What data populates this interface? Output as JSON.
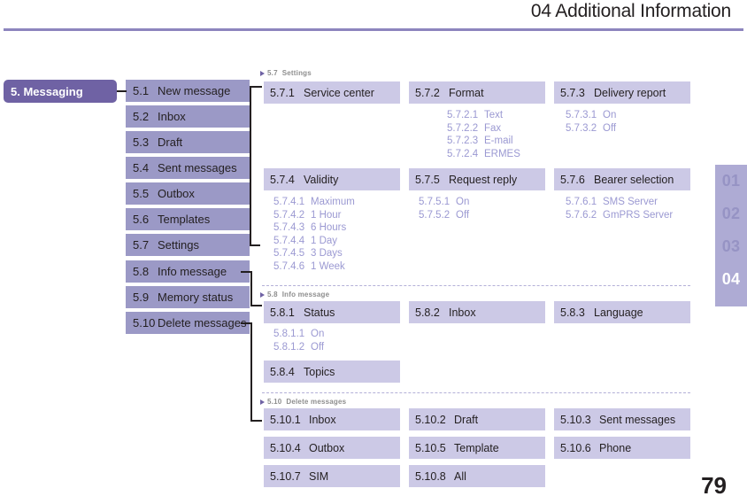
{
  "header": {
    "title": "04 Additional Information"
  },
  "page_number": "79",
  "chapter_tabs": [
    {
      "label": "01",
      "active": false
    },
    {
      "label": "02",
      "active": false
    },
    {
      "label": "03",
      "active": false
    },
    {
      "label": "04",
      "active": true
    }
  ],
  "root": {
    "label": "5. Messaging"
  },
  "menu_level1": [
    {
      "num": "5.1",
      "label": "New message"
    },
    {
      "num": "5.2",
      "label": "Inbox"
    },
    {
      "num": "5.3",
      "label": "Draft"
    },
    {
      "num": "5.4",
      "label": "Sent messages"
    },
    {
      "num": "5.5",
      "label": "Outbox"
    },
    {
      "num": "5.6",
      "label": "Templates"
    },
    {
      "num": "5.7",
      "label": "Settings"
    },
    {
      "num": "5.8",
      "label": "Info message"
    },
    {
      "num": "5.9",
      "label": "Memory status"
    },
    {
      "num": "5.10",
      "label": "Delete messages"
    }
  ],
  "sections": [
    {
      "id": "settings",
      "head_num": "5.7",
      "head_label": "Settings",
      "boxes": [
        {
          "num": "5.7.1",
          "label": "Service center",
          "children": []
        },
        {
          "num": "5.7.2",
          "label": "Format",
          "children": [
            {
              "num": "5.7.2.1",
              "label": "Text"
            },
            {
              "num": "5.7.2.2",
              "label": "Fax"
            },
            {
              "num": "5.7.2.3",
              "label": "E-mail"
            },
            {
              "num": "5.7.2.4",
              "label": "ERMES"
            }
          ]
        },
        {
          "num": "5.7.3",
          "label": "Delivery report",
          "children": [
            {
              "num": "5.7.3.1",
              "label": "On"
            },
            {
              "num": "5.7.3.2",
              "label": "Off"
            }
          ]
        },
        {
          "num": "5.7.4",
          "label": "Validity",
          "children": [
            {
              "num": "5.7.4.1",
              "label": "Maximum"
            },
            {
              "num": "5.7.4.2",
              "label": "1 Hour"
            },
            {
              "num": "5.7.4.3",
              "label": "6 Hours"
            },
            {
              "num": "5.7.4.4",
              "label": "1 Day"
            },
            {
              "num": "5.7.4.5",
              "label": "3 Days"
            },
            {
              "num": "5.7.4.6",
              "label": "1 Week"
            }
          ]
        },
        {
          "num": "5.7.5",
          "label": "Request reply",
          "children": [
            {
              "num": "5.7.5.1",
              "label": "On"
            },
            {
              "num": "5.7.5.2",
              "label": "Off"
            }
          ]
        },
        {
          "num": "5.7.6",
          "label": "Bearer selection",
          "children": [
            {
              "num": "5.7.6.1",
              "label": "SMS Server"
            },
            {
              "num": "5.7.6.2",
              "label": "GmPRS Server"
            }
          ]
        }
      ]
    },
    {
      "id": "info-message",
      "head_num": "5.8",
      "head_label": "Info message",
      "boxes": [
        {
          "num": "5.8.1",
          "label": "Status",
          "children": [
            {
              "num": "5.8.1.1",
              "label": "On"
            },
            {
              "num": "5.8.1.2",
              "label": "Off"
            }
          ]
        },
        {
          "num": "5.8.2",
          "label": "Inbox",
          "children": []
        },
        {
          "num": "5.8.3",
          "label": "Language",
          "children": []
        },
        {
          "num": "5.8.4",
          "label": "Topics",
          "children": []
        }
      ]
    },
    {
      "id": "delete-messages",
      "head_num": "5.10",
      "head_label": "Delete messages",
      "boxes": [
        {
          "num": "5.10.1",
          "label": "Inbox",
          "children": []
        },
        {
          "num": "5.10.2",
          "label": "Draft",
          "children": []
        },
        {
          "num": "5.10.3",
          "label": "Sent messages",
          "children": []
        },
        {
          "num": "5.10.4",
          "label": "Outbox",
          "children": []
        },
        {
          "num": "5.10.5",
          "label": "Template",
          "children": []
        },
        {
          "num": "5.10.6",
          "label": "Phone",
          "children": []
        },
        {
          "num": "5.10.7",
          "label": "SIM",
          "children": []
        },
        {
          "num": "5.10.8",
          "label": "All",
          "children": []
        }
      ]
    }
  ],
  "colors": {
    "accent_dark": "#6f62a4",
    "level1_box": "#9b99c6",
    "level2_box": "#ccc9e6",
    "leaf_text": "#9b99d2",
    "rule": "#8d85be",
    "tab_strip": "#aeabd4"
  }
}
